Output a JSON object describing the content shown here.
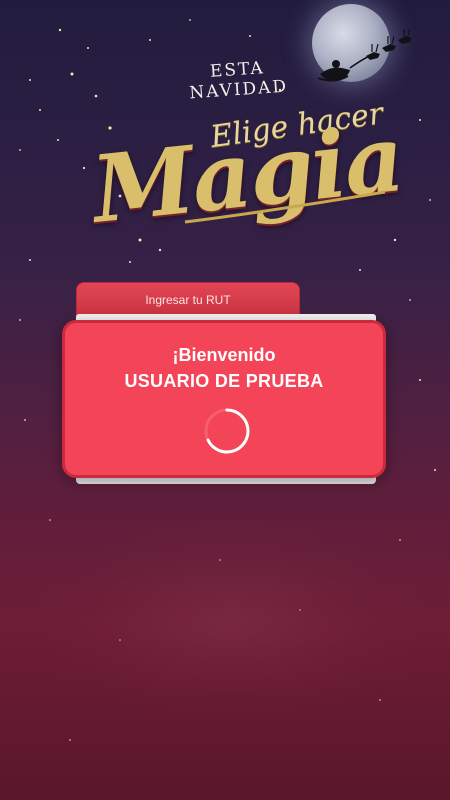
{
  "header": {
    "tagline": "ESTA NAVIDAD",
    "script_line": "Elige hacer",
    "big_word": "Magia"
  },
  "login": {
    "rut_tab_label": "Ingresar tu RUT",
    "rut_masked_value": "●●●●●●●●●●"
  },
  "welcome_modal": {
    "greeting": "¡Bienvenido",
    "user_name": "USUARIO DE PRUEBA",
    "loading": true
  },
  "colors": {
    "modal_bg": "#f44458",
    "modal_border": "#c92a3d",
    "gold": "#d9bf6b",
    "sky_top": "#211c3e",
    "sky_bottom": "#5a1729"
  },
  "icons": {
    "moon": "moon-icon",
    "sleigh": "santa-sleigh-icon",
    "spinner": "loading-spinner-icon"
  }
}
